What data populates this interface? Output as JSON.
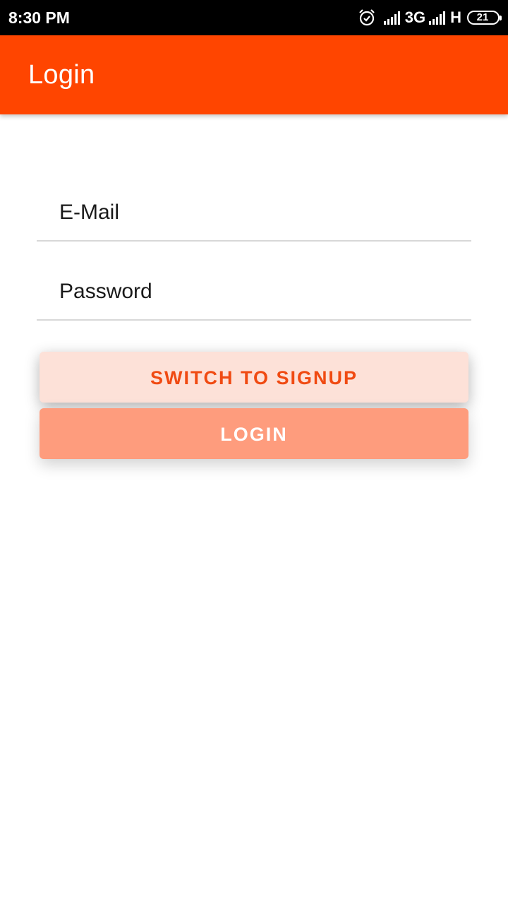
{
  "status_bar": {
    "time": "8:30 PM",
    "network_1": "3G",
    "network_2": "H",
    "battery": "21",
    "icons": [
      "alarm-icon",
      "signal-icon",
      "signal-icon",
      "battery-icon"
    ]
  },
  "app_bar": {
    "title": "Login",
    "color": "#ff4500"
  },
  "form": {
    "email": {
      "placeholder": "E-Mail",
      "value": ""
    },
    "password": {
      "placeholder": "Password",
      "value": ""
    }
  },
  "buttons": {
    "switch_label": "SWITCH TO SIGNUP",
    "login_label": "LOGIN"
  }
}
